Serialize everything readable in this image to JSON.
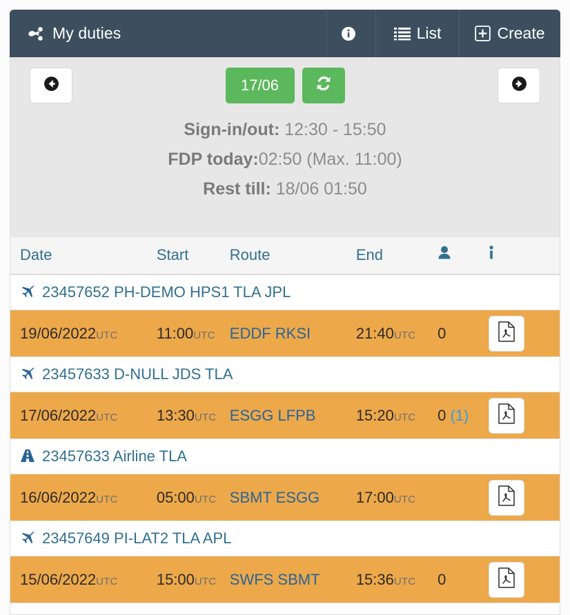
{
  "header": {
    "title": "My duties",
    "title_icon": "share-alt-icon",
    "buttons": [
      {
        "name": "info",
        "label": "",
        "icon": "info-circle-icon"
      },
      {
        "name": "list",
        "label": "List",
        "icon": "list-icon"
      },
      {
        "name": "create",
        "label": "Create",
        "icon": "plus-square-icon"
      }
    ]
  },
  "nav": {
    "prev_icon": "arrow-circle-left-icon",
    "next_icon": "arrow-circle-right-icon",
    "date_label": "17/06",
    "refresh_icon": "refresh-icon"
  },
  "summary": {
    "signinout_label": "Sign-in/out:",
    "signinout_value": " 12:30 - 15:50",
    "fdp_label": "FDP today:",
    "fdp_value": "02:50 (Max. 11:00)",
    "rest_label": "Rest till:",
    "rest_value": " 18/06 01:50"
  },
  "table": {
    "columns": {
      "date": "Date",
      "start": "Start",
      "route": "Route",
      "end": "End",
      "pax": "",
      "doc": ""
    },
    "pax_icon": "user-icon",
    "doc_icon": "info-icon",
    "groups": [
      {
        "icon": "plane-icon",
        "label": "23457652 PH-DEMO HPS1 TLA JPL",
        "rows": [
          {
            "date": "19/06/2022",
            "date_suffix": "UTC",
            "start": "11:00",
            "start_suffix": "UTC",
            "route": "EDDF RKSI",
            "end": "21:40",
            "end_suffix": "UTC",
            "pax": "0",
            "pax_extra": "",
            "doc_icon": "file-pdf-icon"
          }
        ]
      },
      {
        "icon": "plane-icon",
        "label": "23457633 D-NULL JDS TLA",
        "rows": [
          {
            "date": "17/06/2022",
            "date_suffix": "UTC",
            "start": "13:30",
            "start_suffix": "UTC",
            "route": "ESGG LFPB",
            "end": "15:20",
            "end_suffix": "UTC",
            "pax": "0",
            "pax_extra": "(1)",
            "doc_icon": "file-pdf-icon"
          }
        ]
      },
      {
        "icon": "road-icon",
        "label": "23457633 Airline TLA",
        "rows": [
          {
            "date": "16/06/2022",
            "date_suffix": "UTC",
            "start": "05:00",
            "start_suffix": "UTC",
            "route": "SBMT ESGG",
            "end": "17:00",
            "end_suffix": "UTC",
            "pax": "",
            "pax_extra": "",
            "doc_icon": "file-pdf-icon"
          }
        ]
      },
      {
        "icon": "plane-icon",
        "label": "23457649 PI-LAT2 TLA APL",
        "rows": [
          {
            "date": "15/06/2022",
            "date_suffix": "UTC",
            "start": "15:00",
            "start_suffix": "UTC",
            "route": "SWFS SBMT",
            "end": "15:36",
            "end_suffix": "UTC",
            "pax": "0",
            "pax_extra": "",
            "doc_icon": "file-pdf-icon"
          }
        ]
      }
    ]
  },
  "colors": {
    "header_bg": "#3d4f5e",
    "panel_bg": "#e7e7e7",
    "accent_green": "#5cb85c",
    "row_orange": "#eda84a",
    "link_blue": "#31708f"
  }
}
